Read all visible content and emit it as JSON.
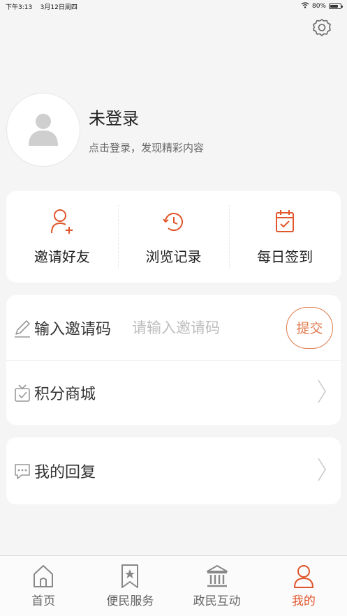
{
  "status_bar": {
    "time": "下午3:13",
    "date": "3月12日周四",
    "battery": "80%"
  },
  "profile": {
    "name": "未登录",
    "subtitle": "点击登录，发现精彩内容"
  },
  "quick_actions": [
    {
      "label": "邀请好友",
      "icon": "add-user-icon"
    },
    {
      "label": "浏览记录",
      "icon": "history-clock-icon"
    },
    {
      "label": "每日签到",
      "icon": "calendar-check-icon"
    }
  ],
  "invite": {
    "label": "输入邀请码",
    "placeholder": "请输入邀请码",
    "value": "",
    "submit_label": "提交"
  },
  "menu": {
    "points_mall": "积分商城",
    "my_replies": "我的回复"
  },
  "tabbar": {
    "items": [
      {
        "label": "首页",
        "icon": "home-icon"
      },
      {
        "label": "便民服务",
        "icon": "bookmark-star-icon"
      },
      {
        "label": "政民互动",
        "icon": "government-building-icon"
      },
      {
        "label": "我的",
        "icon": "user-icon"
      }
    ],
    "active_index": 3
  },
  "colors": {
    "accent": "#e0552a",
    "accent_light": "#e07a4c",
    "background": "#f5f5f5",
    "card": "#ffffff"
  }
}
